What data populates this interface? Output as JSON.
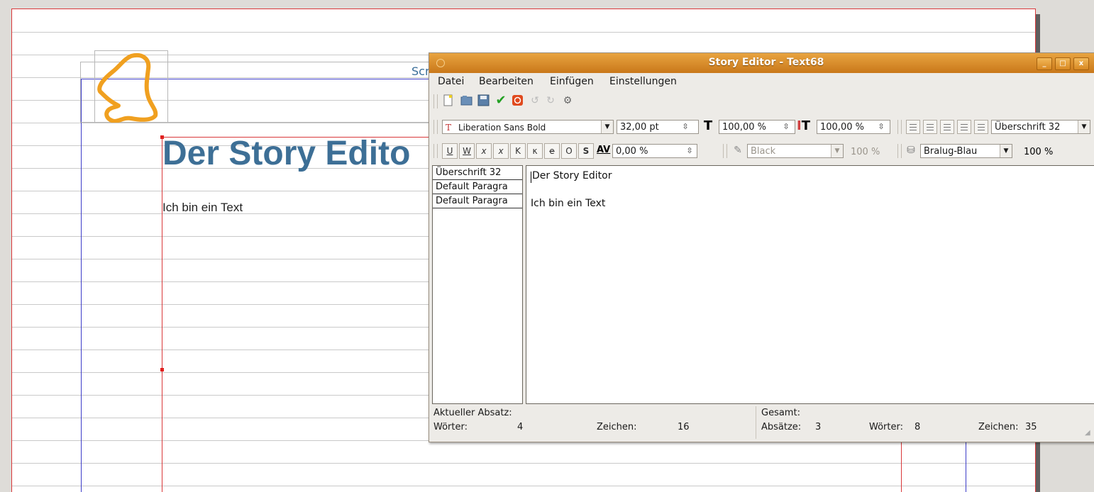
{
  "document": {
    "header_snippet": "Scr",
    "heading": "Der Story Edito",
    "body_text": "Ich bin ein Text"
  },
  "window": {
    "title": "Story Editor - Text68",
    "buttons": {
      "minimize": "_",
      "maximize": "□",
      "close": "x"
    }
  },
  "menu": {
    "items": [
      {
        "label": "Datei"
      },
      {
        "label": "Bearbeiten"
      },
      {
        "label": "Einfügen"
      },
      {
        "label": "Einstellungen"
      }
    ]
  },
  "toolbar": {
    "icons": [
      "new-icon",
      "open-icon",
      "save-icon",
      "apply-icon",
      "cancel-icon",
      "undo-icon",
      "redo-icon",
      "search-replace-icon"
    ]
  },
  "font_toolbar": {
    "font_name": "Liberation Sans Bold",
    "font_size": "32,00 pt",
    "scale_width": "100,00 %",
    "scale_height": "100,00 %",
    "paragraph_style": "Überschrift 32"
  },
  "format_toolbar": {
    "buttons": [
      "U",
      "W",
      "x",
      "x",
      "K",
      "κ",
      "e",
      "O",
      "S"
    ],
    "tracking": "0,00 %",
    "stroke_color": "Black",
    "stroke_shade": "100 %",
    "fill_color": "Bralug-Blau",
    "fill_shade": "100 %"
  },
  "style_pane": {
    "items": [
      "Überschrift 32",
      "Default Paragra",
      "Default Paragra"
    ]
  },
  "text_pane": {
    "paragraphs": [
      "Der Story Editor",
      "",
      "Ich bin ein Text"
    ]
  },
  "status": {
    "current_label": "Aktueller Absatz:",
    "words_label": "Wörter:",
    "words_value": "4",
    "chars_label": "Zeichen:",
    "chars_value": "16",
    "total_label": "Gesamt:",
    "paragraphs_label": "Absätze:",
    "paragraphs_value": "3",
    "total_words_label": "Wörter:",
    "total_words_value": "8",
    "total_chars_label": "Zeichen:",
    "total_chars_value": "35"
  },
  "colors": {
    "title_gradient_top": "#e8a440",
    "title_gradient_bottom": "#c9781a",
    "heading_blue": "#3d6f96",
    "logo_orange": "#f0a020",
    "guide_red": "#d9383a",
    "guide_blue": "#3c3cc8"
  }
}
